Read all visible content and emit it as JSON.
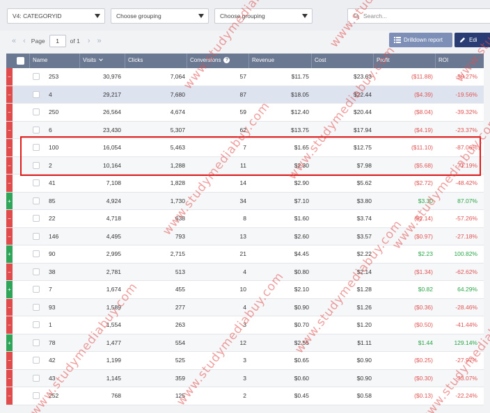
{
  "toolbar": {
    "group1": "V4: CATEGORYID",
    "group2": "Choose grouping",
    "group3": "Choose grouping",
    "search_placeholder": "Search...",
    "page_label": "Page",
    "page_value": "1",
    "page_of": "of 1",
    "drilldown_label": "Drilldown report",
    "edit_label": "Edi"
  },
  "columns": {
    "name": "Name",
    "visits": "Visits",
    "clicks": "Clicks",
    "conversions": "Conversions",
    "revenue": "Revenue",
    "cost": "Cost",
    "profit": "Profit",
    "roi": "ROI"
  },
  "rows": [
    {
      "status": "−",
      "name": "253",
      "visits": "30,976",
      "clicks": "7,064",
      "conv": "57",
      "revenue": "$11.75",
      "cost": "$23.63",
      "profit": "($11.88)",
      "roi": "-50.27%"
    },
    {
      "status": "−",
      "name": "4",
      "visits": "29,217",
      "clicks": "7,680",
      "conv": "87",
      "revenue": "$18.05",
      "cost": "$22.44",
      "profit": "($4.39)",
      "roi": "-19.56%"
    },
    {
      "status": "−",
      "name": "250",
      "visits": "26,564",
      "clicks": "4,674",
      "conv": "59",
      "revenue": "$12.40",
      "cost": "$20.44",
      "profit": "($8.04)",
      "roi": "-39.32%"
    },
    {
      "status": "−",
      "name": "6",
      "visits": "23,430",
      "clicks": "5,307",
      "conv": "62",
      "revenue": "$13.75",
      "cost": "$17.94",
      "profit": "($4.19)",
      "roi": "-23.37%"
    },
    {
      "status": "−",
      "name": "100",
      "visits": "16,054",
      "clicks": "5,463",
      "conv": "7",
      "revenue": "$1.65",
      "cost": "$12.75",
      "profit": "($11.10)",
      "roi": "-87.06%"
    },
    {
      "status": "−",
      "name": "2",
      "visits": "10,164",
      "clicks": "1,288",
      "conv": "11",
      "revenue": "$2.30",
      "cost": "$7.98",
      "profit": "($5.68)",
      "roi": "-71.19%"
    },
    {
      "status": "−",
      "name": "41",
      "visits": "7,108",
      "clicks": "1,828",
      "conv": "14",
      "revenue": "$2.90",
      "cost": "$5.62",
      "profit": "($2.72)",
      "roi": "-48.42%"
    },
    {
      "status": "+",
      "name": "85",
      "visits": "4,924",
      "clicks": "1,730",
      "conv": "34",
      "revenue": "$7.10",
      "cost": "$3.80",
      "profit": "$3.30",
      "roi": "87.07%"
    },
    {
      "status": "−",
      "name": "22",
      "visits": "4,718",
      "clicks": "638",
      "conv": "8",
      "revenue": "$1.60",
      "cost": "$3.74",
      "profit": "($2.14)",
      "roi": "-57.26%"
    },
    {
      "status": "−",
      "name": "146",
      "visits": "4,495",
      "clicks": "793",
      "conv": "13",
      "revenue": "$2.60",
      "cost": "$3.57",
      "profit": "($0.97)",
      "roi": "-27.18%"
    },
    {
      "status": "+",
      "name": "90",
      "visits": "2,995",
      "clicks": "2,715",
      "conv": "21",
      "revenue": "$4.45",
      "cost": "$2.22",
      "profit": "$2.23",
      "roi": "100.82%"
    },
    {
      "status": "−",
      "name": "38",
      "visits": "2,781",
      "clicks": "513",
      "conv": "4",
      "revenue": "$0.80",
      "cost": "$2.14",
      "profit": "($1.34)",
      "roi": "-62.62%"
    },
    {
      "status": "+",
      "name": "7",
      "visits": "1,674",
      "clicks": "455",
      "conv": "10",
      "revenue": "$2.10",
      "cost": "$1.28",
      "profit": "$0.82",
      "roi": "64.29%"
    },
    {
      "status": "−",
      "name": "93",
      "visits": "1,589",
      "clicks": "277",
      "conv": "4",
      "revenue": "$0.90",
      "cost": "$1.26",
      "profit": "($0.36)",
      "roi": "-28.46%"
    },
    {
      "status": "−",
      "name": "1",
      "visits": "1,554",
      "clicks": "263",
      "conv": "3",
      "revenue": "$0.70",
      "cost": "$1.20",
      "profit": "($0.50)",
      "roi": "-41.44%"
    },
    {
      "status": "+",
      "name": "78",
      "visits": "1,477",
      "clicks": "554",
      "conv": "12",
      "revenue": "$2.55",
      "cost": "$1.11",
      "profit": "$1.44",
      "roi": "129.14%"
    },
    {
      "status": "−",
      "name": "42",
      "visits": "1,199",
      "clicks": "525",
      "conv": "3",
      "revenue": "$0.65",
      "cost": "$0.90",
      "profit": "($0.25)",
      "roi": "-27.97%"
    },
    {
      "status": "−",
      "name": "43",
      "visits": "1,145",
      "clicks": "359",
      "conv": "3",
      "revenue": "$0.60",
      "cost": "$0.90",
      "profit": "($0.30)",
      "roi": "-33.07%"
    },
    {
      "status": "−",
      "name": "252",
      "visits": "768",
      "clicks": "125",
      "conv": "2",
      "revenue": "$0.45",
      "cost": "$0.58",
      "profit": "($0.13)",
      "roi": "-22.24%"
    }
  ],
  "watermark": "www.studymediabuy.com",
  "colors": {
    "loss": "#e04c4c",
    "gain": "#2ea558",
    "header": "#6b7891",
    "highlight": "#e01818"
  }
}
